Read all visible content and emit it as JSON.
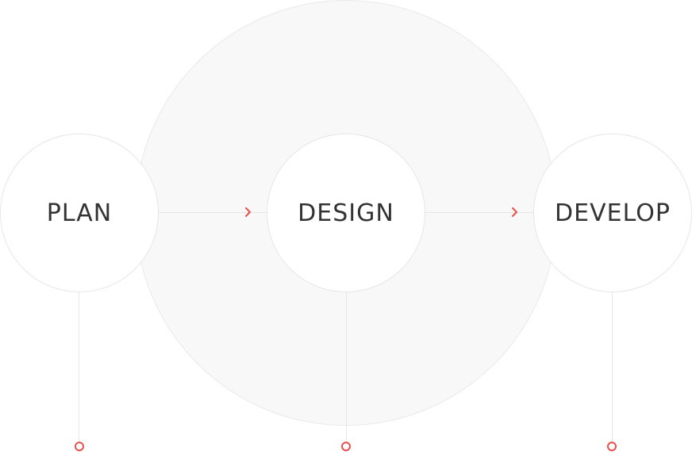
{
  "diagram": {
    "stages": [
      {
        "label": "PLAN"
      },
      {
        "label": "DESIGN"
      },
      {
        "label": "DEVELOP"
      }
    ],
    "colors": {
      "accent": "#e8504f",
      "text": "#333333",
      "line": "#e6e6e6",
      "halo": "#f8f8f8"
    },
    "icons": {
      "connector": "chevron-right-icon",
      "endpoint": "circle-outline-icon"
    }
  }
}
